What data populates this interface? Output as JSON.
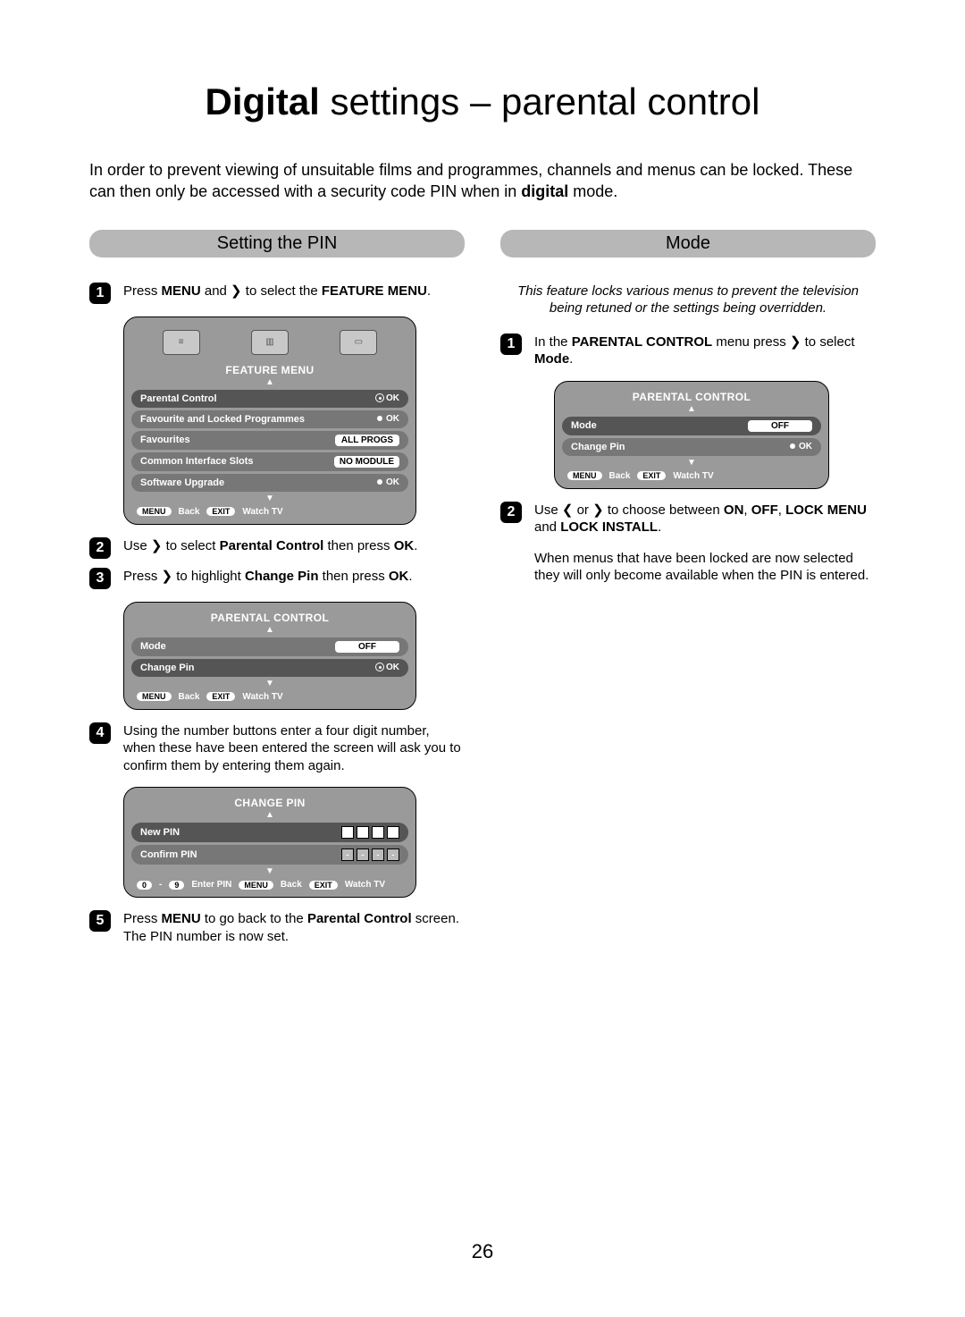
{
  "title_bold": "Digital",
  "title_rest": " settings – parental control",
  "intro_a": "In order to prevent viewing of unsuitable films and programmes, channels and menus can be locked. These can then only be accessed with a security code PIN when in ",
  "intro_b": "digital",
  "intro_c": " mode.",
  "left": {
    "heading": "Setting the PIN",
    "step1_a": "Press ",
    "step1_b": "MENU",
    "step1_c": " and ❯ to select the ",
    "step1_d": "FEATURE MENU",
    "step1_e": ".",
    "step2_a": "Use ❯ to select ",
    "step2_b": "Parental Control",
    "step2_c": " then press ",
    "step2_d": "OK",
    "step2_e": ".",
    "step3_a": "Press ❯ to highlight ",
    "step3_b": "Change Pin",
    "step3_c": " then press ",
    "step3_d": "OK",
    "step3_e": ".",
    "step4": "Using the number buttons enter a four digit number, when these have been entered the screen will ask you to confirm them by entering them again.",
    "step5_a": "Press ",
    "step5_b": "MENU",
    "step5_c": " to go back to the ",
    "step5_d": "Parental Control",
    "step5_e": " screen. The PIN number is now set."
  },
  "right": {
    "heading": "Mode",
    "intro": "This feature locks various menus to prevent the television being retuned or the settings being overridden.",
    "step1_a": "In the ",
    "step1_b": "PARENTAL CONTROL",
    "step1_c": " menu press ❯ to select ",
    "step1_d": "Mode",
    "step1_e": ".",
    "step2_a": "Use ❮ or ❯ to choose between ",
    "step2_b": "ON",
    "step2_c": ", ",
    "step2_d": "OFF",
    "step2_e": ", ",
    "step2_f": "LOCK MENU",
    "step2_g": " and ",
    "step2_h": "LOCK INSTALL",
    "step2_i": ".",
    "note": "When menus that have been locked are now selected they will only become available when the PIN is entered."
  },
  "panels": {
    "feature": {
      "title": "FEATURE MENU",
      "rows": [
        {
          "label": "Parental Control",
          "val": "",
          "ok": "OK",
          "sel": true,
          "ring": true
        },
        {
          "label": "Favourite and Locked Programmes",
          "val": "",
          "ok": "OK",
          "dot": true
        },
        {
          "label": "Favourites",
          "val": "ALL PROGS"
        },
        {
          "label": "Common Interface Slots",
          "val": "NO MODULE"
        },
        {
          "label": "Software Upgrade",
          "val": "",
          "ok": "OK",
          "dot": true
        }
      ],
      "hint_menu": "MENU",
      "hint_back": "Back",
      "hint_exit": "EXIT",
      "hint_watch": "Watch TV"
    },
    "parental1": {
      "title": "PARENTAL CONTROL",
      "rows": [
        {
          "label": "Mode",
          "val": "OFF"
        },
        {
          "label": "Change Pin",
          "val": "",
          "ok": "OK",
          "sel": true,
          "ring": true
        }
      ],
      "hint_menu": "MENU",
      "hint_back": "Back",
      "hint_exit": "EXIT",
      "hint_watch": "Watch TV"
    },
    "changepin": {
      "title": "CHANGE PIN",
      "rows": [
        {
          "label": "New PIN",
          "pin": [
            "*",
            "*",
            "*",
            "*"
          ],
          "sel": true
        },
        {
          "label": "Confirm PIN",
          "pin": [
            "-",
            "-",
            "-",
            "-"
          ]
        }
      ],
      "hint_09a": "0",
      "hint_09b": "9",
      "hint_enter": "Enter PIN",
      "hint_menu": "MENU",
      "hint_back": "Back",
      "hint_exit": "EXIT",
      "hint_watch": "Watch TV"
    },
    "parental2": {
      "title": "PARENTAL CONTROL",
      "rows": [
        {
          "label": "Mode",
          "val": "OFF",
          "sel": true
        },
        {
          "label": "Change Pin",
          "val": "",
          "ok": "OK",
          "dot": true
        }
      ],
      "hint_menu": "MENU",
      "hint_back": "Back",
      "hint_exit": "EXIT",
      "hint_watch": "Watch TV"
    }
  },
  "page_number": "26"
}
